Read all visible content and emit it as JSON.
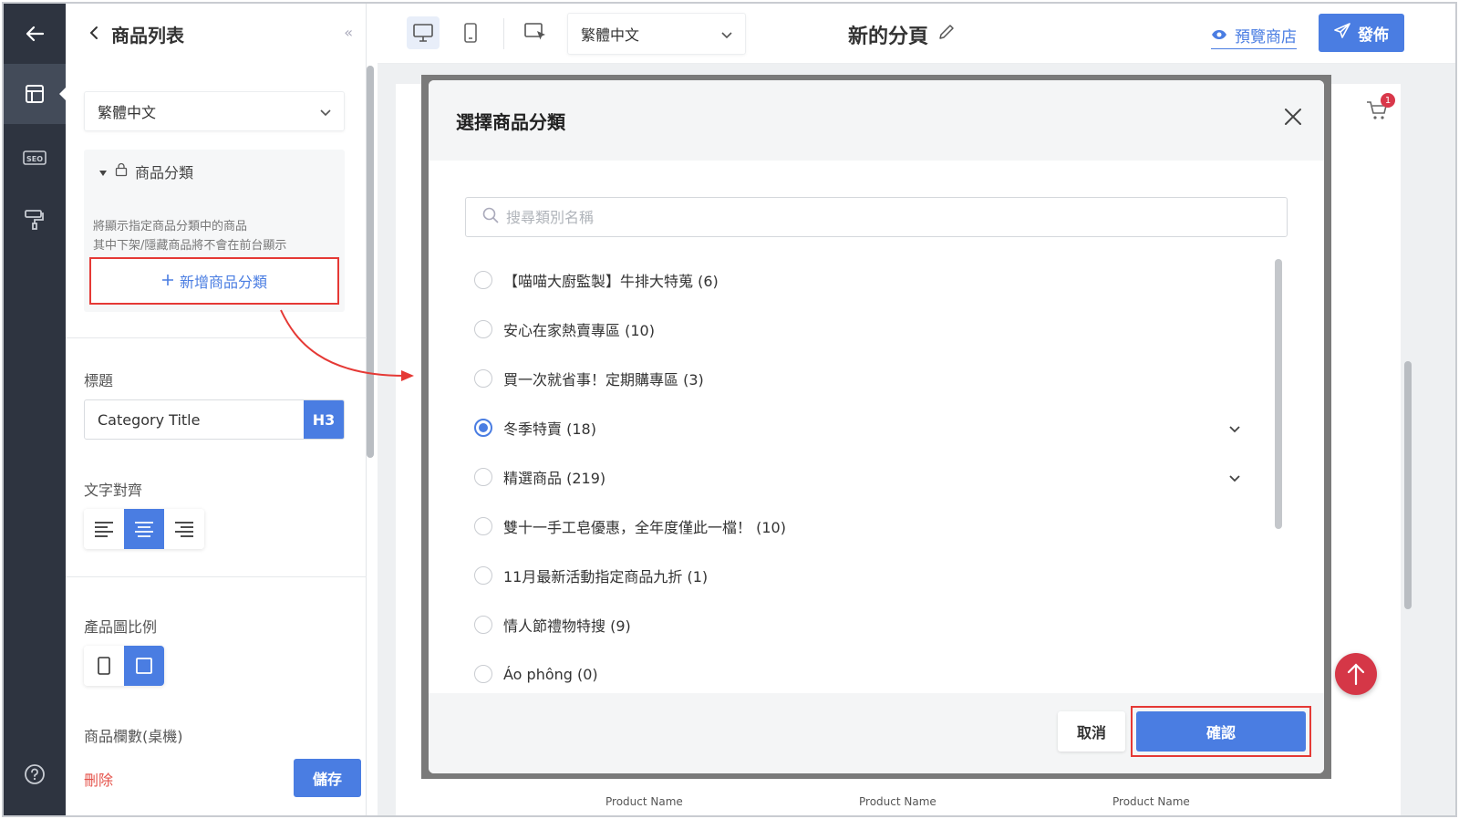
{
  "sidebar": {
    "icons": [
      "back-arrow-icon",
      "layout-icon",
      "seo-icon",
      "paint-roller-icon"
    ],
    "help_icon": "help-circle-icon"
  },
  "panel": {
    "title": "商品列表",
    "language": "繁體中文",
    "category_section": {
      "title": "商品分類",
      "description_line1": "將顯示指定商品分類中的商品",
      "description_line2": "其中下架/隱藏商品將不會在前台顯示",
      "add_button": "新增商品分類"
    },
    "title_label": "標題",
    "title_value": "Category Title",
    "heading_level": "H3",
    "text_align_label": "文字對齊",
    "text_align_selected": "center",
    "image_ratio_label": "產品圖比例",
    "image_ratio_selected": "square",
    "columns_label": "商品欄數(桌機)",
    "delete_label": "刪除",
    "save_label": "儲存"
  },
  "toolbar": {
    "language": "繁體中文",
    "page_name": "新的分頁",
    "preview_label": "預覽商店",
    "publish_label": "發佈"
  },
  "canvas": {
    "cart_count": "1",
    "product_name_label": "Product Name"
  },
  "modal": {
    "title": "選擇商品分類",
    "search_placeholder": "搜尋類別名稱",
    "items": [
      {
        "label": "【喵喵大廚監製】牛排大特蒐 (6)",
        "selected": false,
        "expandable": false
      },
      {
        "label": "安心在家熱賣專區 (10)",
        "selected": false,
        "expandable": false
      },
      {
        "label": "買一次就省事！定期購專區 (3)",
        "selected": false,
        "expandable": false
      },
      {
        "label": "冬季特賣 (18)",
        "selected": true,
        "expandable": true
      },
      {
        "label": "精選商品 (219)",
        "selected": false,
        "expandable": true
      },
      {
        "label": "雙十一手工皂優惠，全年度僅此一檔！ (10)",
        "selected": false,
        "expandable": false
      },
      {
        "label": "11月最新活動指定商品九折 (1)",
        "selected": false,
        "expandable": false
      },
      {
        "label": "情人節禮物特搜 (9)",
        "selected": false,
        "expandable": false
      },
      {
        "label": "Áo phông (0)",
        "selected": false,
        "expandable": false
      }
    ],
    "cancel_label": "取消",
    "confirm_label": "確認"
  },
  "colors": {
    "primary": "#4a7de2",
    "rail": "#2e3440",
    "highlight_border": "#e53935",
    "fab": "#d53747"
  }
}
